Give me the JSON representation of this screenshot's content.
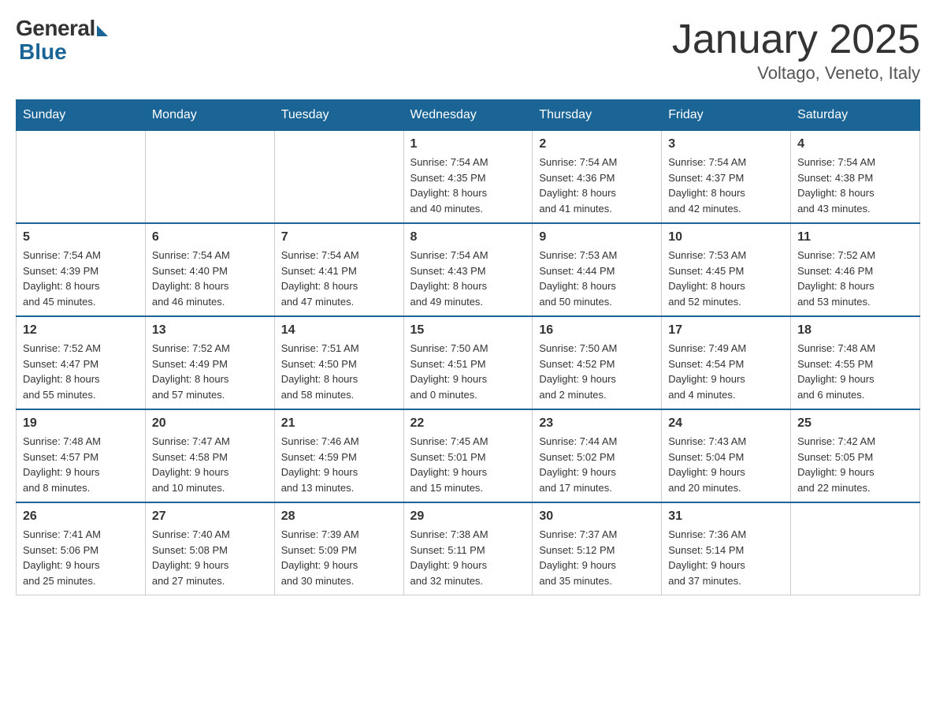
{
  "logo": {
    "general": "General",
    "blue": "Blue"
  },
  "title": "January 2025",
  "subtitle": "Voltago, Veneto, Italy",
  "weekdays": [
    "Sunday",
    "Monday",
    "Tuesday",
    "Wednesday",
    "Thursday",
    "Friday",
    "Saturday"
  ],
  "weeks": [
    [
      {
        "day": "",
        "info": ""
      },
      {
        "day": "",
        "info": ""
      },
      {
        "day": "",
        "info": ""
      },
      {
        "day": "1",
        "info": "Sunrise: 7:54 AM\nSunset: 4:35 PM\nDaylight: 8 hours\nand 40 minutes."
      },
      {
        "day": "2",
        "info": "Sunrise: 7:54 AM\nSunset: 4:36 PM\nDaylight: 8 hours\nand 41 minutes."
      },
      {
        "day": "3",
        "info": "Sunrise: 7:54 AM\nSunset: 4:37 PM\nDaylight: 8 hours\nand 42 minutes."
      },
      {
        "day": "4",
        "info": "Sunrise: 7:54 AM\nSunset: 4:38 PM\nDaylight: 8 hours\nand 43 minutes."
      }
    ],
    [
      {
        "day": "5",
        "info": "Sunrise: 7:54 AM\nSunset: 4:39 PM\nDaylight: 8 hours\nand 45 minutes."
      },
      {
        "day": "6",
        "info": "Sunrise: 7:54 AM\nSunset: 4:40 PM\nDaylight: 8 hours\nand 46 minutes."
      },
      {
        "day": "7",
        "info": "Sunrise: 7:54 AM\nSunset: 4:41 PM\nDaylight: 8 hours\nand 47 minutes."
      },
      {
        "day": "8",
        "info": "Sunrise: 7:54 AM\nSunset: 4:43 PM\nDaylight: 8 hours\nand 49 minutes."
      },
      {
        "day": "9",
        "info": "Sunrise: 7:53 AM\nSunset: 4:44 PM\nDaylight: 8 hours\nand 50 minutes."
      },
      {
        "day": "10",
        "info": "Sunrise: 7:53 AM\nSunset: 4:45 PM\nDaylight: 8 hours\nand 52 minutes."
      },
      {
        "day": "11",
        "info": "Sunrise: 7:52 AM\nSunset: 4:46 PM\nDaylight: 8 hours\nand 53 minutes."
      }
    ],
    [
      {
        "day": "12",
        "info": "Sunrise: 7:52 AM\nSunset: 4:47 PM\nDaylight: 8 hours\nand 55 minutes."
      },
      {
        "day": "13",
        "info": "Sunrise: 7:52 AM\nSunset: 4:49 PM\nDaylight: 8 hours\nand 57 minutes."
      },
      {
        "day": "14",
        "info": "Sunrise: 7:51 AM\nSunset: 4:50 PM\nDaylight: 8 hours\nand 58 minutes."
      },
      {
        "day": "15",
        "info": "Sunrise: 7:50 AM\nSunset: 4:51 PM\nDaylight: 9 hours\nand 0 minutes."
      },
      {
        "day": "16",
        "info": "Sunrise: 7:50 AM\nSunset: 4:52 PM\nDaylight: 9 hours\nand 2 minutes."
      },
      {
        "day": "17",
        "info": "Sunrise: 7:49 AM\nSunset: 4:54 PM\nDaylight: 9 hours\nand 4 minutes."
      },
      {
        "day": "18",
        "info": "Sunrise: 7:48 AM\nSunset: 4:55 PM\nDaylight: 9 hours\nand 6 minutes."
      }
    ],
    [
      {
        "day": "19",
        "info": "Sunrise: 7:48 AM\nSunset: 4:57 PM\nDaylight: 9 hours\nand 8 minutes."
      },
      {
        "day": "20",
        "info": "Sunrise: 7:47 AM\nSunset: 4:58 PM\nDaylight: 9 hours\nand 10 minutes."
      },
      {
        "day": "21",
        "info": "Sunrise: 7:46 AM\nSunset: 4:59 PM\nDaylight: 9 hours\nand 13 minutes."
      },
      {
        "day": "22",
        "info": "Sunrise: 7:45 AM\nSunset: 5:01 PM\nDaylight: 9 hours\nand 15 minutes."
      },
      {
        "day": "23",
        "info": "Sunrise: 7:44 AM\nSunset: 5:02 PM\nDaylight: 9 hours\nand 17 minutes."
      },
      {
        "day": "24",
        "info": "Sunrise: 7:43 AM\nSunset: 5:04 PM\nDaylight: 9 hours\nand 20 minutes."
      },
      {
        "day": "25",
        "info": "Sunrise: 7:42 AM\nSunset: 5:05 PM\nDaylight: 9 hours\nand 22 minutes."
      }
    ],
    [
      {
        "day": "26",
        "info": "Sunrise: 7:41 AM\nSunset: 5:06 PM\nDaylight: 9 hours\nand 25 minutes."
      },
      {
        "day": "27",
        "info": "Sunrise: 7:40 AM\nSunset: 5:08 PM\nDaylight: 9 hours\nand 27 minutes."
      },
      {
        "day": "28",
        "info": "Sunrise: 7:39 AM\nSunset: 5:09 PM\nDaylight: 9 hours\nand 30 minutes."
      },
      {
        "day": "29",
        "info": "Sunrise: 7:38 AM\nSunset: 5:11 PM\nDaylight: 9 hours\nand 32 minutes."
      },
      {
        "day": "30",
        "info": "Sunrise: 7:37 AM\nSunset: 5:12 PM\nDaylight: 9 hours\nand 35 minutes."
      },
      {
        "day": "31",
        "info": "Sunrise: 7:36 AM\nSunset: 5:14 PM\nDaylight: 9 hours\nand 37 minutes."
      },
      {
        "day": "",
        "info": ""
      }
    ]
  ]
}
